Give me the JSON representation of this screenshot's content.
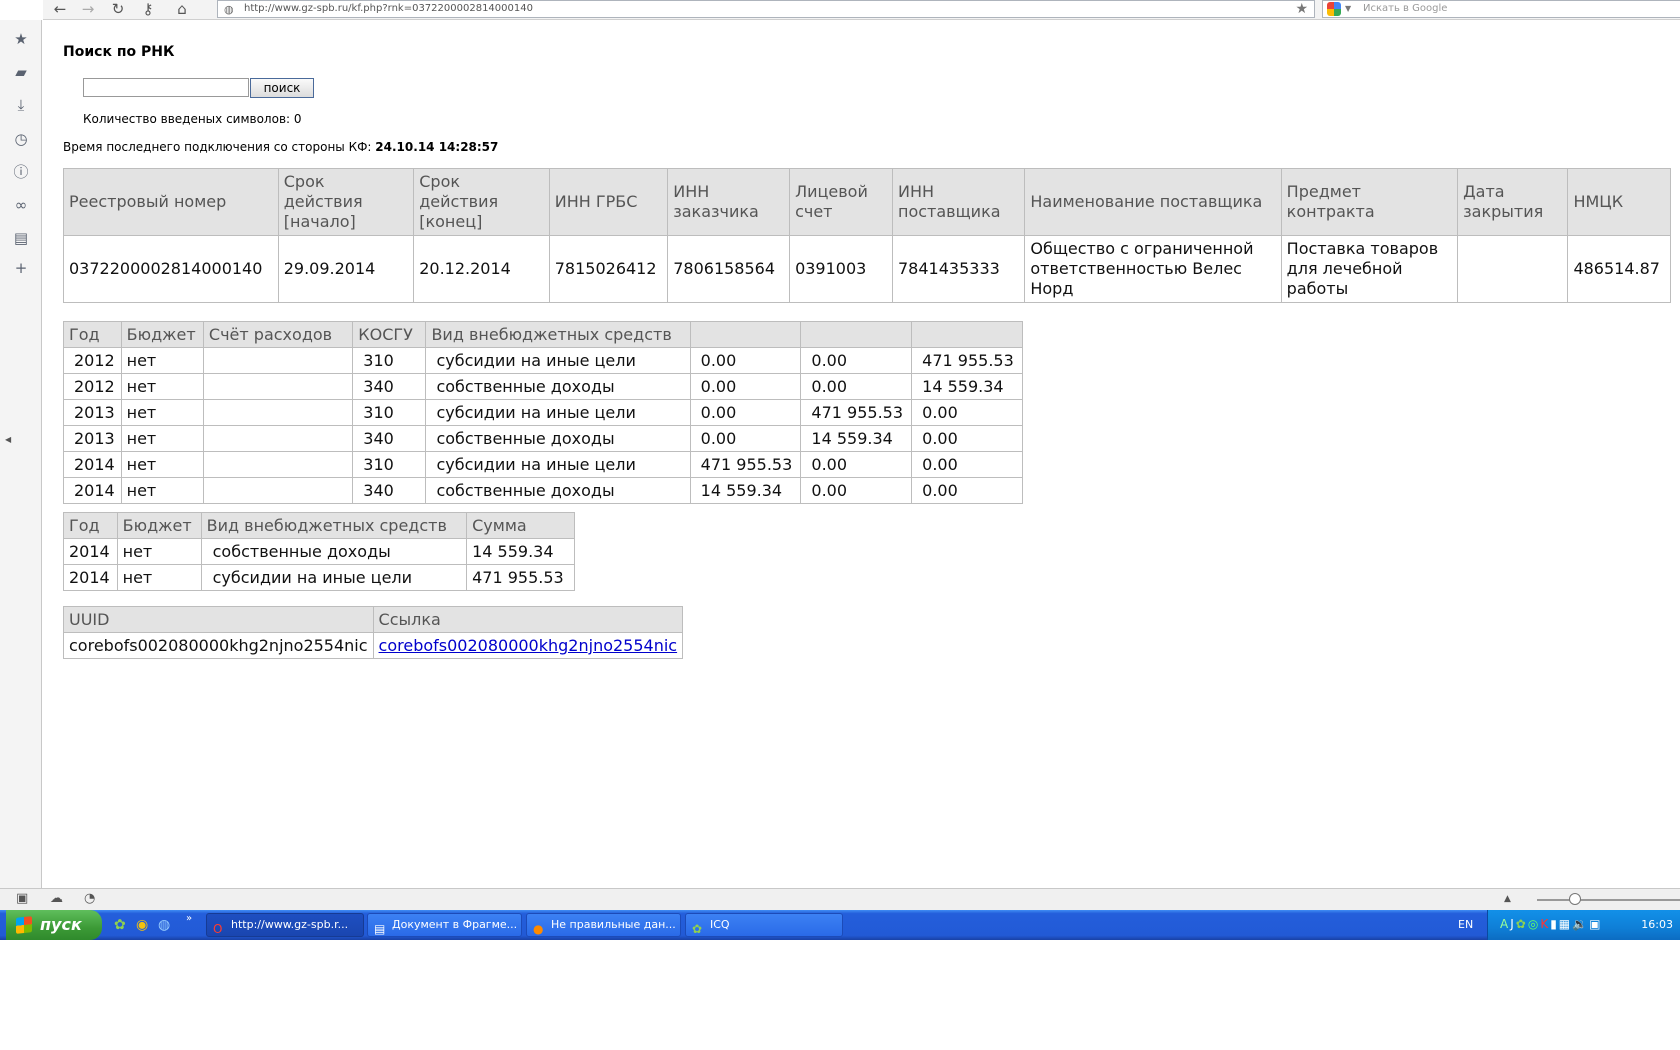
{
  "browser": {
    "url": "http://www.gz-spb.ru/kf.php?rnk=0372200002814000140",
    "search_placeholder": "Искать в Google"
  },
  "page": {
    "title": "Поиск по РНК",
    "search_value": "",
    "search_button": "поиск",
    "char_count_label": "Количество введеных символов: 0",
    "last_connection_label": "Время последнего подключения со стороны КФ:",
    "last_connection_value": "24.10.14 14:28:57"
  },
  "main_table": {
    "headers": [
      "Реестровый номер",
      "Срок действия [начало]",
      "Срок действия [конец]",
      "ИНН ГРБС",
      "ИНН заказчика",
      "Лицевой счет",
      "ИНН поставщика",
      "Наименование поставщика",
      "Предмет контракта",
      "Дата закрытия",
      "НМЦК"
    ],
    "rows": [
      [
        "0372200002814000140",
        "29.09.2014",
        "20.12.2014",
        "7815026412",
        "7806158564",
        "0391003",
        "7841435333",
        "Общество с ограниченной ответственностью Велес Норд",
        "Поставка товаров для лечебной работы",
        "",
        "486514.87"
      ]
    ]
  },
  "finance_table": {
    "headers": [
      "Год",
      "Бюджет",
      "Счёт расходов",
      "КОСГУ",
      "Вид внебюджетных средств",
      "",
      "",
      ""
    ],
    "rows": [
      [
        "2012",
        "нет",
        "",
        "310",
        "субсидии на иные цели",
        "0.00",
        "0.00",
        "471 955.53"
      ],
      [
        "2012",
        "нет",
        "",
        "340",
        "собственные доходы",
        "0.00",
        "0.00",
        "14 559.34"
      ],
      [
        "2013",
        "нет",
        "",
        "310",
        "субсидии на иные цели",
        "0.00",
        "471 955.53",
        "0.00"
      ],
      [
        "2013",
        "нет",
        "",
        "340",
        "собственные доходы",
        "0.00",
        "14 559.34",
        "0.00"
      ],
      [
        "2014",
        "нет",
        "",
        "310",
        "субсидии на иные цели",
        "471 955.53",
        "0.00",
        "0.00"
      ],
      [
        "2014",
        "нет",
        "",
        "340",
        "собственные доходы",
        "14 559.34",
        "0.00",
        "0.00"
      ]
    ]
  },
  "sum_table": {
    "headers": [
      "Год",
      "Бюджет",
      "Вид внебюджетных средств",
      "Сумма"
    ],
    "rows": [
      [
        "2014",
        "нет",
        "собственные доходы",
        "14 559.34"
      ],
      [
        "2014",
        "нет",
        "субсидии на иные цели",
        "471 955.53"
      ]
    ]
  },
  "uuid_table": {
    "headers": [
      "UUID",
      "Ссылка"
    ],
    "rows": [
      [
        "corebofs002080000khg2njno2554nic",
        "corebofs002080000khg2njno2554nic"
      ]
    ]
  },
  "taskbar": {
    "start_label": "пуск",
    "tasks": [
      {
        "label": "http://www.gz-spb.r...",
        "icon": "opera-icon",
        "active": true
      },
      {
        "label": "Документ в Фрагме...",
        "icon": "document-icon",
        "active": false
      },
      {
        "label": "Не правильные дан...",
        "icon": "firefox-icon",
        "active": false
      },
      {
        "label": "ICQ",
        "icon": "icq-icon",
        "active": false
      }
    ],
    "language": "EN",
    "clock": "16:03"
  }
}
